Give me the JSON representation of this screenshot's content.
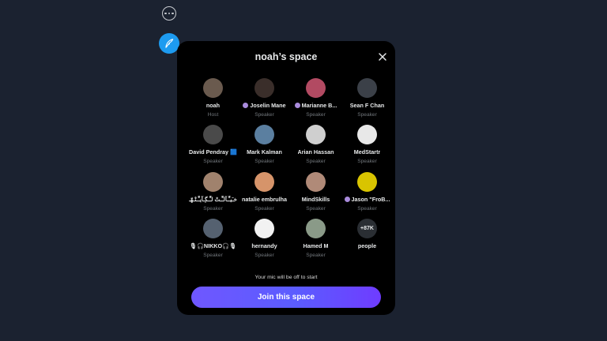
{
  "background": {
    "more_icon": "more-horizontal-icon",
    "compose_icon": "feather-icon",
    "accent_color": "#1d9bf0"
  },
  "modal": {
    "title": "noah’s space",
    "close_icon": "close-icon",
    "mic_notice": "Your mic will be off to start",
    "join_label": "Join this space",
    "participants": [
      {
        "name": "noah",
        "role": "Host",
        "badge": false,
        "color": "#6a5a4e"
      },
      {
        "name": "Joselin Mane",
        "role": "Speaker",
        "badge": true,
        "color": "#3a2e2a"
      },
      {
        "name": "Marianne B...",
        "role": "Speaker",
        "badge": true,
        "color": "#b24a62"
      },
      {
        "name": "Sean F Chan",
        "role": "Speaker",
        "badge": false,
        "color": "#3b4048"
      },
      {
        "name": "David Pendray 🟦",
        "role": "Speaker",
        "badge": false,
        "color": "#4a4a4a"
      },
      {
        "name": "Mark Kalman",
        "role": "Speaker",
        "badge": false,
        "color": "#5b7fa0"
      },
      {
        "name": "Arian Hassan",
        "role": "Speaker",
        "badge": false,
        "color": "#cfcfcf"
      },
      {
        "name": "MedStartr",
        "role": "Speaker",
        "badge": false,
        "color": "#e8e8e8"
      },
      {
        "name": "خـَيـِّـآلـِّـتْ لـِّـگِـآيـِّـتْـهّـ",
        "role": "Speaker",
        "badge": false,
        "color": "#a0826d"
      },
      {
        "name": "natalie embrulha",
        "role": "Speaker",
        "badge": false,
        "color": "#d6946a"
      },
      {
        "name": "MindSkills",
        "role": "Speaker",
        "badge": false,
        "color": "#b08a78"
      },
      {
        "name": "Jason \"FroB...",
        "role": "Speaker",
        "badge": true,
        "color": "#d9c400"
      },
      {
        "name": "🎙🎧NIKKO🎧🎙",
        "role": "Speaker",
        "badge": false,
        "color": "#556170"
      },
      {
        "name": "hernandy",
        "role": "Speaker",
        "badge": false,
        "color": "#f2f2f2"
      },
      {
        "name": "Hamed M",
        "role": "Speaker",
        "badge": false,
        "color": "#8a9a88"
      }
    ],
    "more_count": {
      "label": "+87K",
      "name": "people"
    }
  }
}
